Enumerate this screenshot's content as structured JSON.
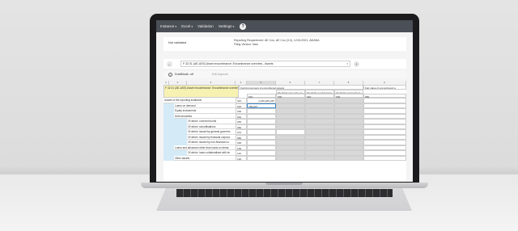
{
  "menubar": {
    "items": [
      {
        "label": "Instance",
        "has_caret": true
      },
      {
        "label": "Excel",
        "has_caret": true
      },
      {
        "label": "Validation",
        "has_caret": false
      },
      {
        "label": "Settings",
        "has_caret": true
      }
    ],
    "help_icon": "?"
  },
  "info": {
    "status": "Not validated",
    "requirement_line1": "Reporting Requirement: AE Con, AE Con (3.0), 12/31/2021, AMANA",
    "requirement_line2": "Filing Version: New"
  },
  "table_selector": {
    "prev_icon": "←",
    "value": "F 32.01 (AE-ASS) Asset encumbrance: Encumbrance overview - Assets",
    "add_icon": "+"
  },
  "mode": {
    "draft_mode": "DraftMode: off",
    "edit_aspects": "Edit Aspects"
  },
  "grid": {
    "col_numbers": [
      "1",
      "2",
      "3",
      "4",
      "5",
      "6",
      "7",
      "8",
      "9"
    ],
    "table_title": "F 32.01 (AE-ASS) Asset encumbrance: Encumbrance overview",
    "group_headers": [
      "Carrying amount of encumbered assets",
      "Fair value of encumbered a"
    ],
    "sub_headers": [
      "Of which: issued by ot",
      "Of which: central bank",
      "Of which: notionally el"
    ],
    "col_codes": [
      "010",
      "030",
      "040",
      "030",
      "050"
    ],
    "rows": [
      {
        "label": "Assets of the reporting institution",
        "code": "010",
        "value": "2,186,489,235",
        "level": 0
      },
      {
        "label": "Loans on demand",
        "code": "020",
        "value": "789,907",
        "level": 1
      },
      {
        "label": "Equity instruments",
        "code": "030",
        "value": "",
        "level": 1
      },
      {
        "label": "Debt securities",
        "code": "040",
        "value": "",
        "level": 1
      },
      {
        "label": "Of which: covered bonds",
        "code": "050",
        "value": "",
        "level": 2
      },
      {
        "label": "Of which: securitisations",
        "code": "060",
        "value": "",
        "level": 2
      },
      {
        "label": "Of which: issued by general governm",
        "code": "070",
        "value": "",
        "level": 2
      },
      {
        "label": "Of which: issued by financial corpora",
        "code": "080",
        "value": "",
        "level": 2
      },
      {
        "label": "Of which: issued by non-financial co",
        "code": "090",
        "value": "",
        "level": 2
      },
      {
        "label": "Loans and advances other than loans on dema",
        "code": "100",
        "value": "",
        "level": 1
      },
      {
        "label": "Of which: loans collateralised with im",
        "code": "110",
        "value": "",
        "level": 2
      },
      {
        "label": "Other assets",
        "code": "120",
        "value": "",
        "level": 1
      }
    ]
  }
}
